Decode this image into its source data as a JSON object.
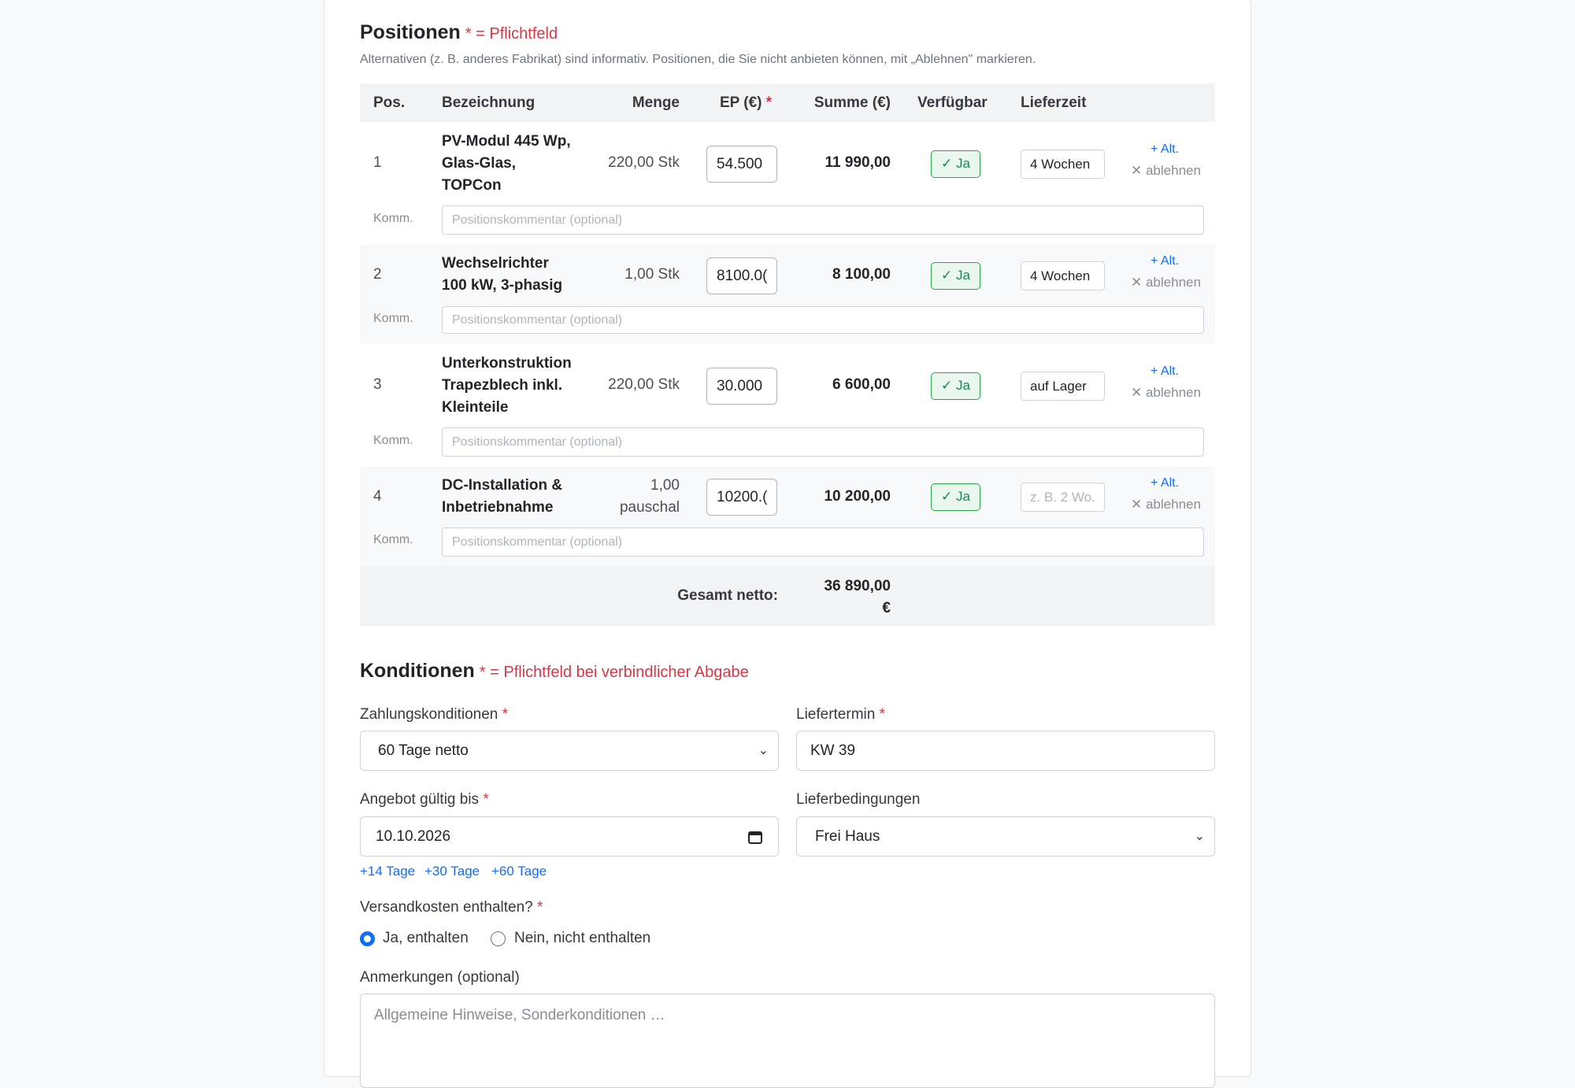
{
  "positions": {
    "title": "Positionen",
    "required_note": "* = Pflichtfeld",
    "hint": "Alternativen (z. B. anderes Fabrikat) sind informativ. Positionen, die Sie nicht anbieten können, mit „Ablehnen\" markieren.",
    "columns": {
      "pos": "Pos.",
      "name": "Bezeichnung",
      "qty": "Menge",
      "ep": "EP (€)",
      "ep_star": "*",
      "sum": "Summe (€)",
      "avail": "Verfügbar",
      "lead": "Lieferzeit"
    },
    "rows": [
      {
        "pos": "1",
        "name": "PV-Modul 445 Wp, Glas-Glas, TOPCon",
        "qty": "220,00 Stk",
        "ep": "54.500",
        "sum": "11 990,00",
        "avail": "✓ Ja",
        "lead": "4 Wochen",
        "alt": "+ Alt.",
        "reject": "ablehnen",
        "comment_label": "Komm.",
        "comment_placeholder": "Positionskommentar (optional)"
      },
      {
        "pos": "2",
        "name": "Wechselrichter 100 kW, 3-phasig",
        "qty": "1,00 Stk",
        "ep": "8100.0(",
        "sum": "8 100,00",
        "avail": "✓ Ja",
        "lead": "4 Wochen",
        "alt": "+ Alt.",
        "reject": "ablehnen",
        "comment_label": "Komm.",
        "comment_placeholder": "Positionskommentar (optional)"
      },
      {
        "pos": "3",
        "name": "Unterkonstruktion Trapezblech inkl. Kleinteile",
        "qty": "220,00 Stk",
        "ep": "30.000",
        "sum": "6 600,00",
        "avail": "✓ Ja",
        "lead": "auf Lager",
        "alt": "+ Alt.",
        "reject": "ablehnen",
        "comment_label": "Komm.",
        "comment_placeholder": "Positionskommentar (optional)"
      },
      {
        "pos": "4",
        "name": "DC-Installation & Inbetriebnahme",
        "qty_line1": "1,00",
        "qty_line2": "pauschal",
        "ep": "10200.(",
        "sum": "10 200,00",
        "avail": "✓ Ja",
        "lead_placeholder": "z. B. 2 Wo.",
        "alt": "+ Alt.",
        "reject": "ablehnen",
        "comment_label": "Komm.",
        "comment_placeholder": "Positionskommentar (optional)"
      }
    ],
    "total_label": "Gesamt netto:",
    "total_value_line1": "36 890,00",
    "total_value_line2": "€"
  },
  "conditions": {
    "title": "Konditionen",
    "required_note": "* = Pflichtfeld bei verbindlicher Abgabe",
    "star": "*",
    "payment_label": "Zahlungskonditionen",
    "payment_value": "60 Tage netto",
    "delivery_date_label": "Liefertermin",
    "delivery_date_value": "KW 39",
    "valid_until_label": "Angebot gültig bis",
    "valid_until_value": "10.10.2026",
    "quick_links": [
      "+14 Tage",
      "+30 Tage",
      "+60 Tage"
    ],
    "delivery_terms_label": "Lieferbedingungen",
    "delivery_terms_value": "Frei Haus",
    "shipping_label": "Versandkosten enthalten?",
    "shipping_yes": "Ja, enthalten",
    "shipping_no": "Nein, nicht enthalten",
    "notes_label": "Anmerkungen (optional)",
    "notes_placeholder": "Allgemeine Hinweise, Sonderkonditionen …"
  }
}
